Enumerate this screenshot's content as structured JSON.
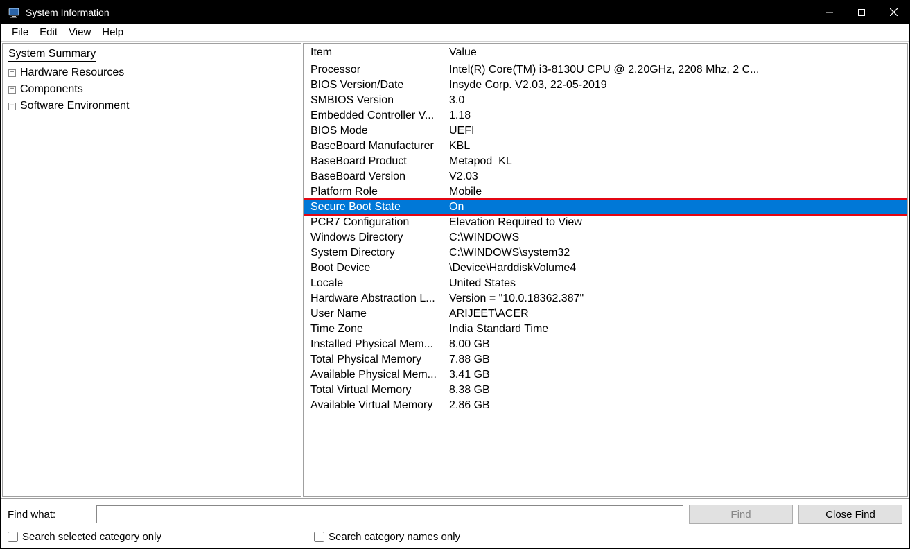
{
  "window": {
    "title": "System Information"
  },
  "menu": {
    "file": "File",
    "edit": "Edit",
    "view": "View",
    "help": "Help"
  },
  "tree": {
    "root": "System Summary",
    "nodes": [
      "Hardware Resources",
      "Components",
      "Software Environment"
    ]
  },
  "columns": {
    "item": "Item",
    "value": "Value"
  },
  "rows": [
    {
      "item": "Processor",
      "value": "Intel(R) Core(TM) i3-8130U CPU @ 2.20GHz, 2208 Mhz, 2 C..."
    },
    {
      "item": "BIOS Version/Date",
      "value": "Insyde Corp. V2.03, 22-05-2019"
    },
    {
      "item": "SMBIOS Version",
      "value": "3.0"
    },
    {
      "item": "Embedded Controller V...",
      "value": "1.18"
    },
    {
      "item": "BIOS Mode",
      "value": "UEFI"
    },
    {
      "item": "BaseBoard Manufacturer",
      "value": "KBL"
    },
    {
      "item": "BaseBoard Product",
      "value": "Metapod_KL"
    },
    {
      "item": "BaseBoard Version",
      "value": "V2.03"
    },
    {
      "item": "Platform Role",
      "value": "Mobile"
    },
    {
      "item": "Secure Boot State",
      "value": "On",
      "selected": true,
      "highlight": true
    },
    {
      "item": "PCR7 Configuration",
      "value": "Elevation Required to View"
    },
    {
      "item": "Windows Directory",
      "value": "C:\\WINDOWS"
    },
    {
      "item": "System Directory",
      "value": "C:\\WINDOWS\\system32"
    },
    {
      "item": "Boot Device",
      "value": "\\Device\\HarddiskVolume4"
    },
    {
      "item": "Locale",
      "value": "United States"
    },
    {
      "item": "Hardware Abstraction L...",
      "value": "Version = \"10.0.18362.387\""
    },
    {
      "item": "User Name",
      "value": "ARIJEET\\ACER"
    },
    {
      "item": "Time Zone",
      "value": "India Standard Time"
    },
    {
      "item": "Installed Physical Mem...",
      "value": "8.00 GB"
    },
    {
      "item": "Total Physical Memory",
      "value": "7.88 GB"
    },
    {
      "item": "Available Physical Mem...",
      "value": "3.41 GB"
    },
    {
      "item": "Total Virtual Memory",
      "value": "8.38 GB"
    },
    {
      "item": "Available Virtual Memory",
      "value": "2.86 GB"
    }
  ],
  "search": {
    "label_prefix": "Find ",
    "label_ul": "w",
    "label_suffix": "hat:",
    "value": "",
    "find_btn_prefix": "Fin",
    "find_btn_ul": "d",
    "close_btn_ul": "C",
    "close_btn_suffix": "lose Find",
    "chk1_ul": "S",
    "chk1_suffix": "earch selected category only",
    "chk2_prefix": "Sear",
    "chk2_ul": "c",
    "chk2_suffix": "h category names only"
  }
}
